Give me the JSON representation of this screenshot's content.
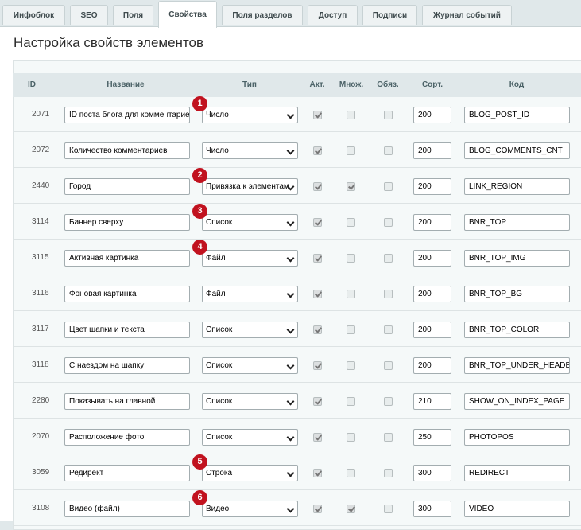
{
  "tabs": [
    {
      "label": "Инфоблок"
    },
    {
      "label": "SEO"
    },
    {
      "label": "Поля"
    },
    {
      "label": "Свойства"
    },
    {
      "label": "Поля разделов"
    },
    {
      "label": "Доступ"
    },
    {
      "label": "Подписи"
    },
    {
      "label": "Журнал событий"
    }
  ],
  "active_tab": "Свойства",
  "page_title": "Настройка свойств элементов",
  "columns": {
    "id": "ID",
    "name": "Название",
    "type": "Тип",
    "active": "Акт.",
    "multiple": "Множ.",
    "required": "Обяз.",
    "sort": "Сорт.",
    "code": "Код"
  },
  "rows": [
    {
      "id": "2071",
      "name": "ID поста блога для комментариев",
      "type": "Число",
      "active": true,
      "multiple": false,
      "required": false,
      "sort": "200",
      "code": "BLOG_POST_ID",
      "marker": "1"
    },
    {
      "id": "2072",
      "name": "Количество комментариев",
      "type": "Число",
      "active": true,
      "multiple": false,
      "required": false,
      "sort": "200",
      "code": "BLOG_COMMENTS_CNT",
      "marker": ""
    },
    {
      "id": "2440",
      "name": "Город",
      "type": "Привязка к элементам",
      "active": true,
      "multiple": true,
      "required": false,
      "sort": "200",
      "code": "LINK_REGION",
      "marker": "2"
    },
    {
      "id": "3114",
      "name": "Баннер сверху",
      "type": "Список",
      "active": true,
      "multiple": false,
      "required": false,
      "sort": "200",
      "code": "BNR_TOP",
      "marker": "3"
    },
    {
      "id": "3115",
      "name": "Активная картинка",
      "type": "Файл",
      "active": true,
      "multiple": false,
      "required": false,
      "sort": "200",
      "code": "BNR_TOP_IMG",
      "marker": "4"
    },
    {
      "id": "3116",
      "name": "Фоновая картинка",
      "type": "Файл",
      "active": true,
      "multiple": false,
      "required": false,
      "sort": "200",
      "code": "BNR_TOP_BG",
      "marker": ""
    },
    {
      "id": "3117",
      "name": "Цвет шапки и текста",
      "type": "Список",
      "active": true,
      "multiple": false,
      "required": false,
      "sort": "200",
      "code": "BNR_TOP_COLOR",
      "marker": ""
    },
    {
      "id": "3118",
      "name": "С наездом на шапку",
      "type": "Список",
      "active": true,
      "multiple": false,
      "required": false,
      "sort": "200",
      "code": "BNR_TOP_UNDER_HEADER",
      "marker": ""
    },
    {
      "id": "2280",
      "name": "Показывать на главной",
      "type": "Список",
      "active": true,
      "multiple": false,
      "required": false,
      "sort": "210",
      "code": "SHOW_ON_INDEX_PAGE",
      "marker": ""
    },
    {
      "id": "2070",
      "name": "Расположение фото",
      "type": "Список",
      "active": true,
      "multiple": false,
      "required": false,
      "sort": "250",
      "code": "PHOTOPOS",
      "marker": ""
    },
    {
      "id": "3059",
      "name": "Редирект",
      "type": "Строка",
      "active": true,
      "multiple": false,
      "required": false,
      "sort": "300",
      "code": "REDIRECT",
      "marker": "5"
    },
    {
      "id": "3108",
      "name": "Видео (файл)",
      "type": "Видео",
      "active": true,
      "multiple": true,
      "required": false,
      "sort": "300",
      "code": "VIDEO",
      "marker": "6"
    }
  ],
  "colors": {
    "marker": "#c1121f",
    "background": "#e0e8ea",
    "panel": "#ffffff"
  },
  "icons": {
    "select_arrow": "chevron-down-icon",
    "checkbox": "checkbox-icon"
  }
}
